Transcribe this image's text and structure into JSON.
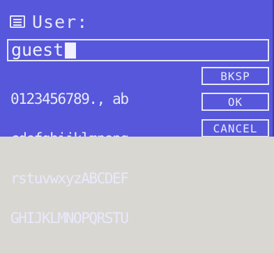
{
  "header": {
    "icon": "menu-icon",
    "title": "User:"
  },
  "input": {
    "value": "guest"
  },
  "charmap": {
    "rows": [
      "0123456789., ab",
      "cdefghijklmnopq",
      "rstuvwxyzABCDEF",
      "GHIJKLMNOPQRSTU"
    ]
  },
  "buttons": {
    "bksp": "BKSP",
    "ok": "OK",
    "cancel": "CANCEL"
  },
  "colors": {
    "screen_bg": "#5757db",
    "text": "#e9e9fc"
  }
}
